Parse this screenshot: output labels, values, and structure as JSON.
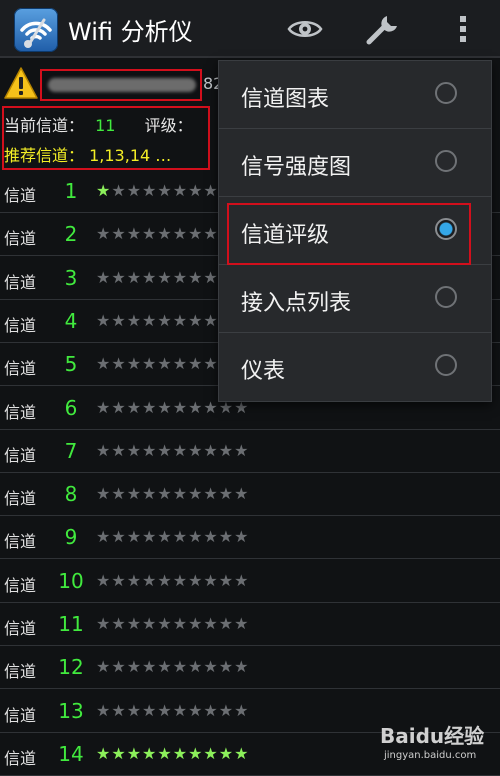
{
  "app": {
    "title": "Wifi 分析仪"
  },
  "ssid": {
    "tail": "82"
  },
  "info": {
    "current_label": "当前信道：",
    "current_value": "11",
    "rating_label": "评级：",
    "recommend_label": "推荐信道：",
    "recommend_value": "1,13,14  …"
  },
  "channels": [
    {
      "label": "信道",
      "num": "1",
      "stars_lit": "★",
      "stars_dim": "★★★★★★★★★"
    },
    {
      "label": "信道",
      "num": "2",
      "stars_lit": "",
      "stars_dim": "★★★★★★★★★★"
    },
    {
      "label": "信道",
      "num": "3",
      "stars_lit": "",
      "stars_dim": "★★★★★★★★★★"
    },
    {
      "label": "信道",
      "num": "4",
      "stars_lit": "",
      "stars_dim": "★★★★★★★★★★"
    },
    {
      "label": "信道",
      "num": "5",
      "stars_lit": "",
      "stars_dim": "★★★★★★★★★★"
    },
    {
      "label": "信道",
      "num": "6",
      "stars_lit": "",
      "stars_dim": "★★★★★★★★★★"
    },
    {
      "label": "信道",
      "num": "7",
      "stars_lit": "",
      "stars_dim": "★★★★★★★★★★"
    },
    {
      "label": "信道",
      "num": "8",
      "stars_lit": "",
      "stars_dim": "★★★★★★★★★★"
    },
    {
      "label": "信道",
      "num": "9",
      "stars_lit": "",
      "stars_dim": "★★★★★★★★★★"
    },
    {
      "label": "信道",
      "num": "10",
      "stars_lit": "",
      "stars_dim": "★★★★★★★★★★"
    },
    {
      "label": "信道",
      "num": "11",
      "stars_lit": "",
      "stars_dim": "★★★★★★★★★★"
    },
    {
      "label": "信道",
      "num": "12",
      "stars_lit": "",
      "stars_dim": "★★★★★★★★★★"
    },
    {
      "label": "信道",
      "num": "13",
      "stars_lit": "",
      "stars_dim": "★★★★★★★★★★"
    },
    {
      "label": "信道",
      "num": "14",
      "stars_lit": "★★★★★★★★★★",
      "stars_dim": ""
    }
  ],
  "menu": {
    "items": [
      {
        "label": "信道图表",
        "selected": false
      },
      {
        "label": "信号强度图",
        "selected": false
      },
      {
        "label": "信道评级",
        "selected": true
      },
      {
        "label": "接入点列表",
        "selected": false
      },
      {
        "label": "仪表",
        "selected": false
      }
    ]
  },
  "watermark": {
    "brand": "Baidu经验",
    "url": "jingyan.baidu.com"
  },
  "colors": {
    "accent_green": "#41ea3e",
    "recommend_yellow": "#f3ee26",
    "highlight_red": "#d20f1c",
    "radio_blue": "#34a7e8"
  }
}
